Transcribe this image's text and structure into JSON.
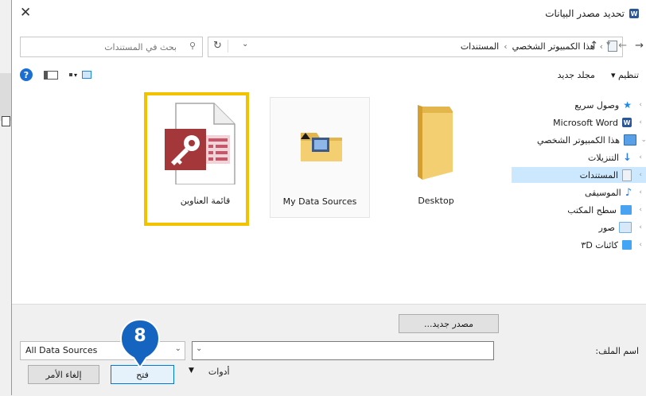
{
  "window": {
    "title": "تحديد مصدر البيانات",
    "close_glyph": "✕"
  },
  "nav": {
    "back_glyph": "→",
    "forward_glyph": "←",
    "recent_glyph": "▾",
    "up_glyph": "↑",
    "breadcrumbs": [
      "هذا الكمبيوتر الشخصي",
      "المستندات"
    ],
    "crumb_sep": "›",
    "address_dropdown_glyph": "⌄",
    "refresh_glyph": "↻",
    "search_placeholder": "بحث في المستندات"
  },
  "toolbar": {
    "organize_label": "تنظيم ▾",
    "new_folder_label": "مجلد جديد",
    "help_label": "?"
  },
  "sidebar": {
    "items": [
      {
        "label": "وصول سريع",
        "icon": "star-icon",
        "color": "#1e88e5",
        "chevron": "›"
      },
      {
        "label": "Microsoft Word",
        "icon": "word-icon",
        "color": "#2b579a",
        "chevron": "›"
      },
      {
        "label": "هذا الكمبيوتر الشخصي",
        "icon": "computer-icon",
        "color": "#5aa0e6",
        "chevron": "⌄"
      },
      {
        "label": "التنزيلات",
        "icon": "download-icon",
        "color": "#2f7fd8",
        "chevron": "›"
      },
      {
        "label": "المستندات",
        "icon": "documents-icon",
        "color": "#9aa6b2",
        "chevron": "›"
      },
      {
        "label": "الموسيقى",
        "icon": "music-icon",
        "color": "#2a7de0",
        "chevron": "›"
      },
      {
        "label": "سطح المكتب",
        "icon": "desktop-icon",
        "color": "#4aa3f0",
        "chevron": "›"
      },
      {
        "label": "صور",
        "icon": "pictures-icon",
        "color": "#6fb1e8",
        "chevron": "›"
      },
      {
        "label": "كائنات ٣D",
        "icon": "3d-objects-icon",
        "color": "#42a5f5",
        "chevron": "›"
      }
    ]
  },
  "files": {
    "items": [
      {
        "label": "Desktop",
        "icon": "folder-icon"
      },
      {
        "label": "My Data Sources",
        "icon": "data-sources-folder-icon"
      },
      {
        "label": "قائمة العناوين",
        "icon": "access-database-icon"
      }
    ]
  },
  "bottom": {
    "new_source_label": "مصدر جديد...",
    "filename_label": "اسم الملف:",
    "filename_value": "",
    "filetype_value": "All Data Sources",
    "tools_label": "أدوات",
    "open_label": "فتح",
    "cancel_label": "إلغاء الأمر"
  },
  "annotation": {
    "step_number": "8",
    "color": "#1565c0"
  },
  "colors": {
    "highlight": "#f2c200",
    "selection": "#cce8ff"
  }
}
